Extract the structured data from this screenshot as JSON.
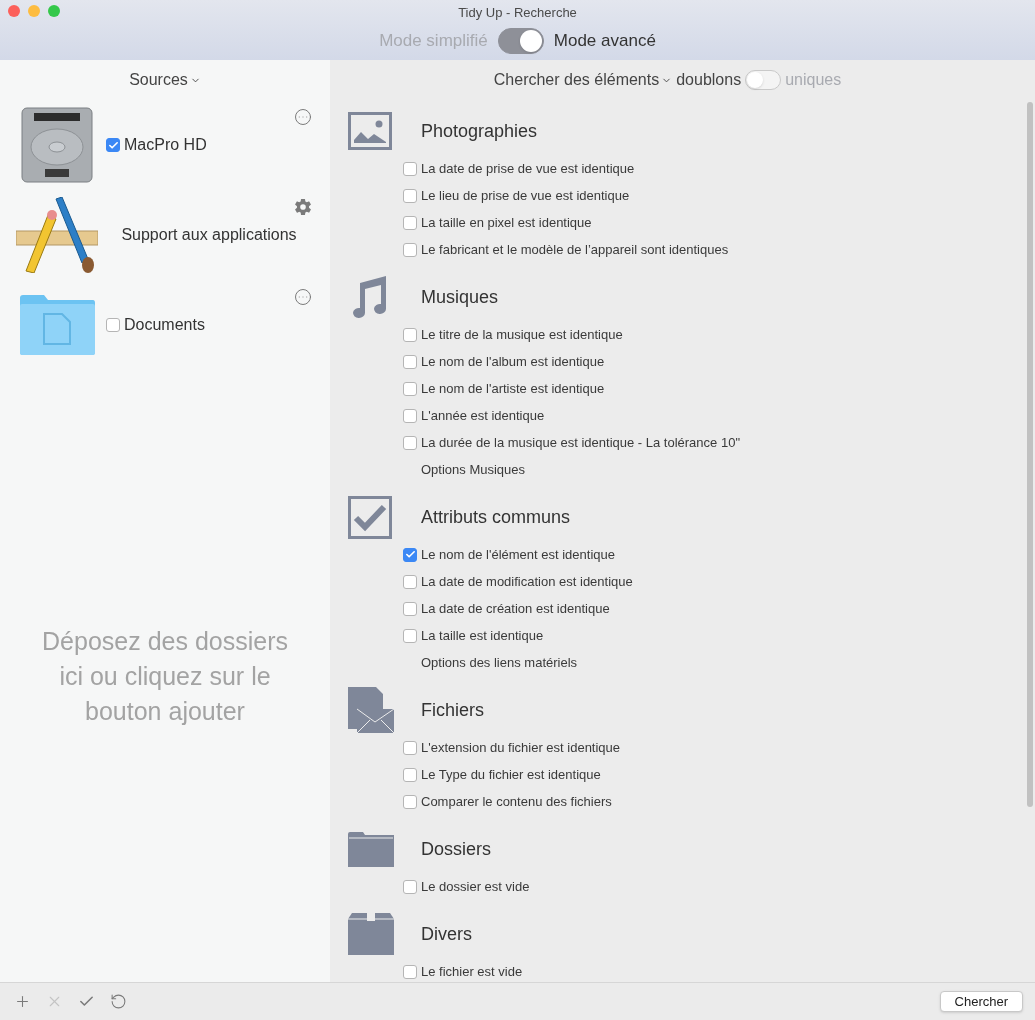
{
  "window": {
    "title": "Tidy Up - Recherche"
  },
  "mode": {
    "left_label": "Mode simplifié",
    "right_label": "Mode avancé",
    "on": true
  },
  "sources": {
    "header": "Sources",
    "items": [
      {
        "kind": "disk",
        "label": "MacPro HD",
        "checked": true,
        "action": {
          "kind": "more"
        }
      },
      {
        "kind": "apps",
        "label": "Support aux applications",
        "action": {
          "kind": "gear"
        }
      },
      {
        "kind": "folder",
        "label": "Documents",
        "checked": false,
        "action": {
          "kind": "more"
        }
      }
    ],
    "drop_hint": "Déposez des dossiers ici ou cliquez sur le bouton ajouter"
  },
  "search": {
    "label": "Chercher des éléments",
    "left_label": "doublons",
    "right_label": "uniques",
    "on": false
  },
  "sections": [
    {
      "kind": "photo",
      "title": "Photographies",
      "options": [
        {
          "label": "La date de prise de vue est identique",
          "checked": false
        },
        {
          "label": "Le lieu de prise de vue est identique",
          "checked": false
        },
        {
          "label": "La taille en pixel est identique",
          "checked": false
        },
        {
          "label": "Le fabricant et le modèle de l’appareil sont identiques",
          "checked": false
        }
      ]
    },
    {
      "kind": "music",
      "title": "Musiques",
      "options": [
        {
          "label": "Le titre de la musique est identique",
          "checked": false
        },
        {
          "label": "Le nom de l'album est identique",
          "checked": false
        },
        {
          "label": "Le nom de l'artiste est identique",
          "checked": false
        },
        {
          "label": "L'année est identique",
          "checked": false
        },
        {
          "label": "La durée de la musique est identique - La tolérance 10\"",
          "checked": false
        }
      ],
      "link": "Options Musiques"
    },
    {
      "kind": "check",
      "title": "Attributs communs",
      "options": [
        {
          "label": "Le nom de l'élément est identique",
          "checked": true
        },
        {
          "label": "La date de modification est identique",
          "checked": false
        },
        {
          "label": "La date de création est identique",
          "checked": false
        },
        {
          "label": "La taille est identique",
          "checked": false
        }
      ],
      "link": "Options des liens matériels"
    },
    {
      "kind": "file",
      "title": "Fichiers",
      "options": [
        {
          "label": "L'extension du fichier est identique",
          "checked": false
        },
        {
          "label": "Le Type du fichier est identique",
          "checked": false
        },
        {
          "label": "Comparer le contenu des fichiers",
          "checked": false
        }
      ]
    },
    {
      "kind": "folder",
      "title": "Dossiers",
      "options": [
        {
          "label": "Le dossier est vide",
          "checked": false
        }
      ]
    },
    {
      "kind": "box",
      "title": "Divers",
      "options": [
        {
          "label": "Le fichier est vide",
          "checked": false
        }
      ]
    }
  ],
  "toolbar": [
    {
      "kind": "add",
      "disabled": false
    },
    {
      "kind": "remove",
      "disabled": true
    },
    {
      "kind": "check",
      "disabled": false
    },
    {
      "kind": "undo",
      "disabled": false
    }
  ],
  "button": "Chercher"
}
